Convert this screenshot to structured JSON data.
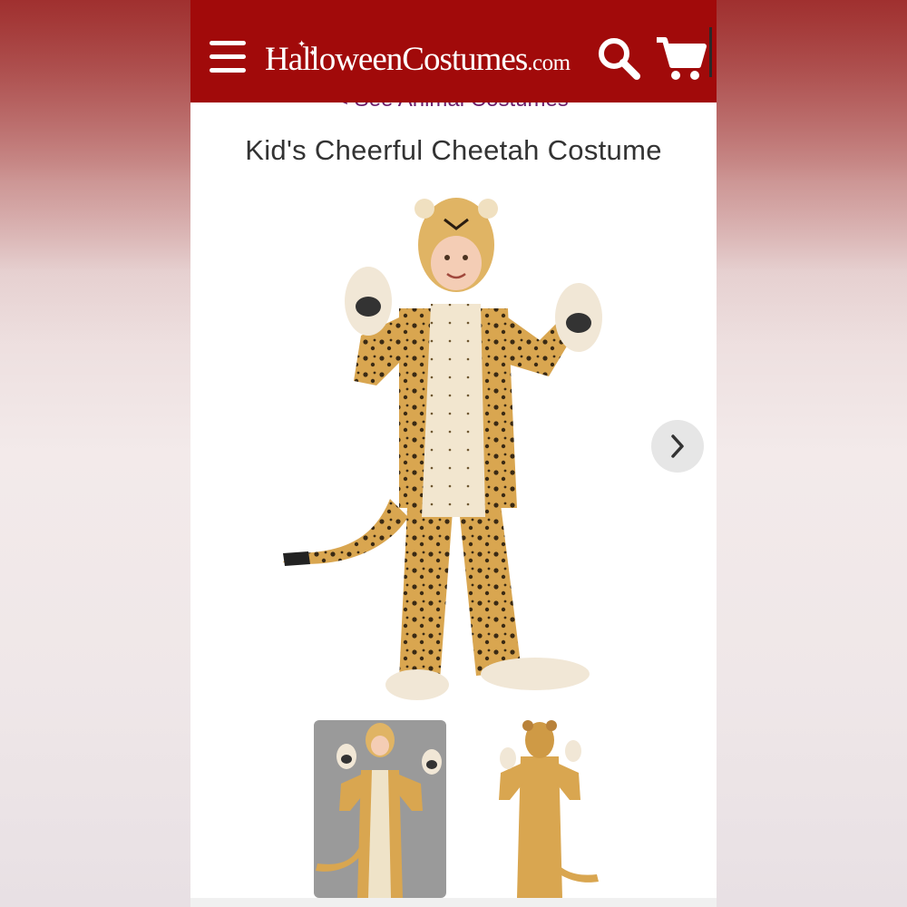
{
  "header": {
    "logo_text": "HalloweenCostumes",
    "logo_suffix": ".com",
    "bg_color": "#a10a0a"
  },
  "icons": {
    "menu": "hamburger-menu-icon",
    "search": "search-icon",
    "cart": "shopping-cart-icon",
    "next": "chevron-right-icon"
  },
  "breadcrumb": {
    "back_label": "< See Animal Costumes"
  },
  "product": {
    "title": "Kid's Cheerful Cheetah Costume"
  },
  "gallery": {
    "thumbnails": [
      {
        "name": "front-view"
      },
      {
        "name": "back-view"
      }
    ],
    "selected_index": 0
  }
}
